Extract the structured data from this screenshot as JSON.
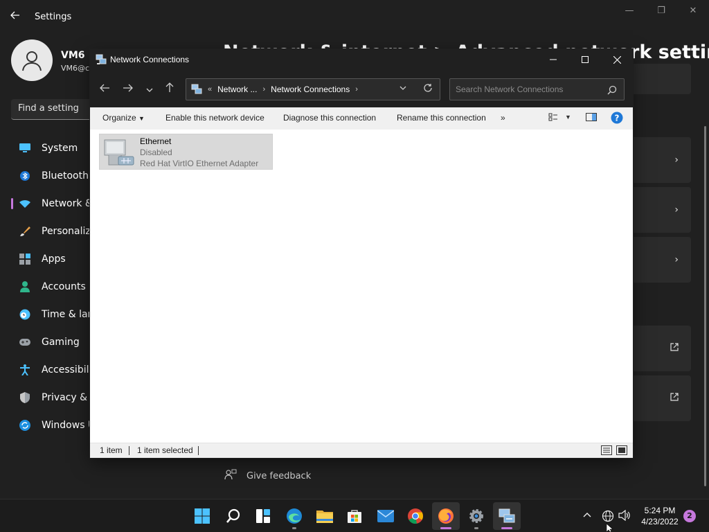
{
  "settings": {
    "title": "Settings",
    "user_name": "VM6",
    "user_email": "VM6@c",
    "search_placeholder": "Find a setting",
    "heading": "Network & internet  >  Advanced network settings",
    "nav": [
      {
        "label": "System",
        "icon": "monitor-icon"
      },
      {
        "label": "Bluetooth & devices",
        "icon": "bluetooth-icon"
      },
      {
        "label": "Network & internet",
        "icon": "wifi-icon"
      },
      {
        "label": "Personalization",
        "icon": "brush-icon"
      },
      {
        "label": "Apps",
        "icon": "apps-icon"
      },
      {
        "label": "Accounts",
        "icon": "person-icon"
      },
      {
        "label": "Time & language",
        "icon": "clock-globe-icon"
      },
      {
        "label": "Gaming",
        "icon": "gamepad-icon"
      },
      {
        "label": "Accessibility",
        "icon": "accessibility-icon"
      },
      {
        "label": "Privacy & security",
        "icon": "shield-icon"
      },
      {
        "label": "Windows Update",
        "icon": "update-icon"
      }
    ],
    "feedback": "Give feedback"
  },
  "window": {
    "title": "Network Connections",
    "breadcrumb": {
      "overflow": "«",
      "parent": "Network ...",
      "current": "Network Connections"
    },
    "search_placeholder": "Search Network Connections",
    "toolbar": {
      "organize": "Organize",
      "enable": "Enable this network device",
      "diagnose": "Diagnose this connection",
      "rename": "Rename this connection",
      "more": "»"
    },
    "items": [
      {
        "name": "Ethernet",
        "status": "Disabled",
        "device": "Red Hat VirtIO Ethernet Adapter"
      }
    ],
    "status": {
      "count": "1 item",
      "selected": "1 item selected"
    }
  },
  "taskbar": {
    "time": "5:24 PM",
    "date": "4/23/2022",
    "notifications": "2",
    "apps": [
      "start-icon",
      "search-icon",
      "widgets-icon",
      "edge-icon",
      "file-explorer-icon",
      "store-icon",
      "mail-icon",
      "chrome-icon",
      "firefox-icon",
      "settings-gear-icon",
      "network-connections-icon"
    ]
  },
  "colors": {
    "accent": "#c678dd",
    "dark_bg": "#202020",
    "help_blue": "#1e78d7"
  }
}
